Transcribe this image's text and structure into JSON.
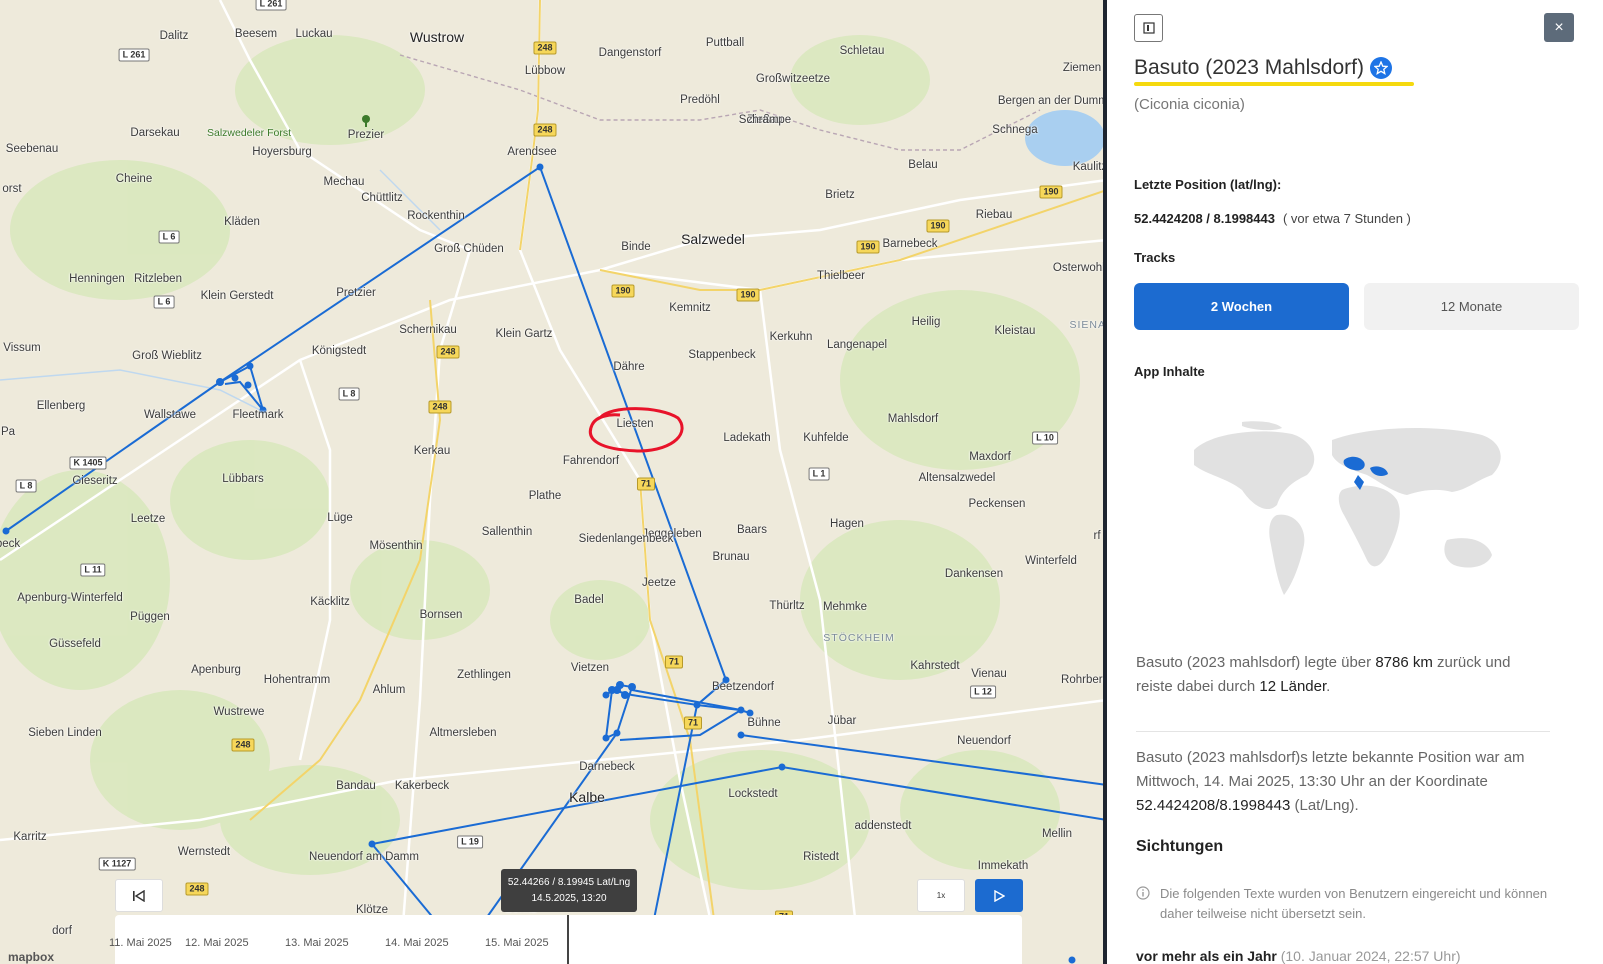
{
  "map": {
    "places": [
      {
        "name": "Dalitz",
        "type": "town"
      },
      {
        "name": "Beesem",
        "type": "town"
      },
      {
        "name": "Luckau",
        "type": "town"
      },
      {
        "name": "Wustrow",
        "type": "town-big"
      },
      {
        "name": "Dangenstorf",
        "type": "town"
      },
      {
        "name": "Puttball",
        "type": "town"
      },
      {
        "name": "Schletau",
        "type": "town"
      },
      {
        "name": "Ziemen",
        "type": "town"
      },
      {
        "name": "Lübbow",
        "type": "town"
      },
      {
        "name": "Großwitzeetze",
        "type": "town"
      },
      {
        "name": "Predöhl",
        "type": "town"
      },
      {
        "name": "Zießau",
        "type": "town"
      },
      {
        "name": "Bergen an der Dumme",
        "type": "town"
      },
      {
        "name": "Darsekau",
        "type": "town"
      },
      {
        "name": "Salzwedeler Forst",
        "type": "forest"
      },
      {
        "name": "Prezier",
        "type": "town"
      },
      {
        "name": "Schrampe",
        "type": "town"
      },
      {
        "name": "Schnega",
        "type": "town"
      },
      {
        "name": "Seebenau",
        "type": "town"
      },
      {
        "name": "Hoyersburg",
        "type": "town"
      },
      {
        "name": "Arendsee",
        "type": "town"
      },
      {
        "name": "Kaulitz",
        "type": "town"
      },
      {
        "name": "Belau",
        "type": "town"
      },
      {
        "name": "Cheine",
        "type": "town"
      },
      {
        "name": "Mechau",
        "type": "town"
      },
      {
        "name": "Brietz",
        "type": "town"
      },
      {
        "name": "Chüttlitz",
        "type": "town"
      },
      {
        "name": "Rockenthin",
        "type": "town"
      },
      {
        "name": "Kläden",
        "type": "town"
      },
      {
        "name": "Riebau",
        "type": "town"
      },
      {
        "name": "Salzwedel",
        "type": "town-big"
      },
      {
        "name": "Groß Chüden",
        "type": "town"
      },
      {
        "name": "Binde",
        "type": "town"
      },
      {
        "name": "Barnebeck",
        "type": "town"
      },
      {
        "name": "Henningen",
        "type": "town"
      },
      {
        "name": "Ritzleben",
        "type": "town"
      },
      {
        "name": "Thielbeer",
        "type": "town"
      },
      {
        "name": "Osterwohle",
        "type": "town"
      },
      {
        "name": "Klein Gerstedt",
        "type": "town"
      },
      {
        "name": "Pretzier",
        "type": "town"
      },
      {
        "name": "Kemnitz",
        "type": "town"
      },
      {
        "name": "Schernikau",
        "type": "town"
      },
      {
        "name": "Heilig",
        "type": "town"
      },
      {
        "name": "SIENAU",
        "type": "region"
      },
      {
        "name": "Klein Gartz",
        "type": "town"
      },
      {
        "name": "Kerkuhn",
        "type": "town"
      },
      {
        "name": "Kleistau",
        "type": "town"
      },
      {
        "name": "Vissum",
        "type": "town"
      },
      {
        "name": "Langenapel",
        "type": "town"
      },
      {
        "name": "Groß Wieblitz",
        "type": "town"
      },
      {
        "name": "Königstedt",
        "type": "town"
      },
      {
        "name": "Stappenbeck",
        "type": "town"
      },
      {
        "name": "Dähre",
        "type": "town"
      },
      {
        "name": "Ellenberg",
        "type": "town"
      },
      {
        "name": "Wallstawe",
        "type": "town"
      },
      {
        "name": "Fleetmark",
        "type": "town"
      },
      {
        "name": "Mahlsdorf",
        "type": "town"
      },
      {
        "name": "Liesten",
        "type": "town"
      },
      {
        "name": "Ladekath",
        "type": "town"
      },
      {
        "name": "Kuhfelde",
        "type": "town"
      },
      {
        "name": "Kerkau",
        "type": "town"
      },
      {
        "name": "Maxdorf",
        "type": "town"
      },
      {
        "name": "Fahrendorf",
        "type": "town"
      },
      {
        "name": "Gieseritz",
        "type": "town"
      },
      {
        "name": "Lübbars",
        "type": "town"
      },
      {
        "name": "Altensalzwedel",
        "type": "town"
      },
      {
        "name": "Plathe",
        "type": "town"
      },
      {
        "name": "Peckensen",
        "type": "town"
      },
      {
        "name": "Leetze",
        "type": "town"
      },
      {
        "name": "Lüge",
        "type": "town"
      },
      {
        "name": "Hagen",
        "type": "town"
      },
      {
        "name": "Sallenthin",
        "type": "town"
      },
      {
        "name": "Jeggeleben",
        "type": "town"
      },
      {
        "name": "Baars",
        "type": "town"
      },
      {
        "name": "Siedenlangenbeck",
        "type": "town"
      },
      {
        "name": "Mösenthin",
        "type": "town"
      },
      {
        "name": "Brunau",
        "type": "town"
      },
      {
        "name": "Winterfeld",
        "type": "town"
      },
      {
        "name": "Jeetze",
        "type": "town"
      },
      {
        "name": "Dankensen",
        "type": "town"
      },
      {
        "name": "Apenburg-Winterfeld",
        "type": "town"
      },
      {
        "name": "Badel",
        "type": "town"
      },
      {
        "name": "Thürltz",
        "type": "town"
      },
      {
        "name": "Mehmke",
        "type": "town"
      },
      {
        "name": "Püggen",
        "type": "town"
      },
      {
        "name": "Käcklitz",
        "type": "town"
      },
      {
        "name": "Bornsen",
        "type": "town"
      },
      {
        "name": "Güssefeld",
        "type": "town"
      },
      {
        "name": "STÖCKHEIM",
        "type": "region"
      },
      {
        "name": "Apenburg",
        "type": "town"
      },
      {
        "name": "Vietzen",
        "type": "town"
      },
      {
        "name": "Kahrstedt",
        "type": "town"
      },
      {
        "name": "Vienau",
        "type": "town"
      },
      {
        "name": "Rohrberg",
        "type": "town"
      },
      {
        "name": "Hohentramm",
        "type": "town"
      },
      {
        "name": "Zethlingen",
        "type": "town"
      },
      {
        "name": "Beetzendorf",
        "type": "town"
      },
      {
        "name": "Ahlum",
        "type": "town"
      },
      {
        "name": "Wustrewe",
        "type": "town"
      },
      {
        "name": "Bühne",
        "type": "town"
      },
      {
        "name": "Jübar",
        "type": "town"
      },
      {
        "name": "Sieben Linden",
        "type": "town"
      },
      {
        "name": "Altmersleben",
        "type": "town"
      },
      {
        "name": "Neuendorf",
        "type": "town"
      },
      {
        "name": "Darnebeck",
        "type": "town"
      },
      {
        "name": "Bandau",
        "type": "town"
      },
      {
        "name": "Kakerbeck",
        "type": "town"
      },
      {
        "name": "Lockstedt",
        "type": "town"
      },
      {
        "name": "Kalbe",
        "type": "town-big"
      },
      {
        "name": "addenstedt",
        "type": "town"
      },
      {
        "name": "Karritz",
        "type": "town"
      },
      {
        "name": "Mellin",
        "type": "town"
      },
      {
        "name": "Wernstedt",
        "type": "town"
      },
      {
        "name": "Ristedt",
        "type": "town"
      },
      {
        "name": "Neuendorf am Damm",
        "type": "town"
      },
      {
        "name": "Immekath",
        "type": "town"
      },
      {
        "name": "Klötze",
        "type": "town"
      },
      {
        "name": "Benitz",
        "type": "town"
      },
      {
        "name": "dorf",
        "type": "town"
      },
      {
        "name": "beck",
        "type": "town"
      },
      {
        "name": "orst",
        "type": "town"
      },
      {
        "name": "Pa",
        "type": "town"
      },
      {
        "name": "rf",
        "type": "town"
      }
    ],
    "road_shields": [
      "L 261",
      "L 261",
      "248",
      "248",
      "248",
      "248",
      "248",
      "248",
      "190",
      "190",
      "190",
      "190",
      "190",
      "L 6",
      "L 6",
      "L 8",
      "K 1405",
      "L 8",
      "L 11",
      "71",
      "71",
      "71",
      "71",
      "L 1",
      "L 10",
      "L 12",
      "L 19",
      "K 1127"
    ],
    "tooltip": {
      "coords": "52.44266 / 8.19945 Lat/Lng",
      "time": "14.5.2025, 13:20"
    },
    "speed_label": "1x",
    "timeline_labels": [
      "11. Mai 2025",
      "12. Mai 2025",
      "13. Mai 2025",
      "14. Mai 2025",
      "15. Mai 2025"
    ],
    "attribution": "mapbox",
    "colors": {
      "track": "#1a6bd4",
      "water": "#a9cff0",
      "forest": "#d5e6b9",
      "road": "#ffffff",
      "highway": "#f6d75a",
      "highlight_circle": "#e8132a"
    }
  },
  "panel": {
    "title": "Basuto (2023 Mahlsdorf)",
    "scientific_name": "(Ciconia ciconia)",
    "last_position_label": "Letzte Position (lat/lng):",
    "last_position_value": "52.4424208 / 8.1998443",
    "last_position_ago": "( vor etwa 7 Stunden )",
    "tracks_label": "Tracks",
    "tab_2w": "2 Wochen",
    "tab_12m": "12 Monate",
    "app_content_label": "App Inhalte",
    "summary_1": "Basuto (2023 mahlsdorf) legte über",
    "summary_km": "8786 km",
    "summary_2": "zurück und reiste dabei durch",
    "summary_countries": "12 Länder",
    "summary_3": ".",
    "last_known_1": "Basuto (2023 mahlsdorf)s letzte bekannte Position war am Mittwoch, 14. Mai 2025, 13:30 Uhr an der Koordinate",
    "last_known_coord": "52.4424208/8.1998443",
    "last_known_2": "(Lat/Lng).",
    "sightings_label": "Sichtungen",
    "sightings_note": "Die folgenden Texte wurden von Benutzern eingereicht und können daher teilweise nicht übersetzt sein.",
    "first_sighting_ago": "vor mehr als ein Jahr",
    "first_sighting_date": "(10. Januar 2024, 22:57 Uhr)"
  }
}
